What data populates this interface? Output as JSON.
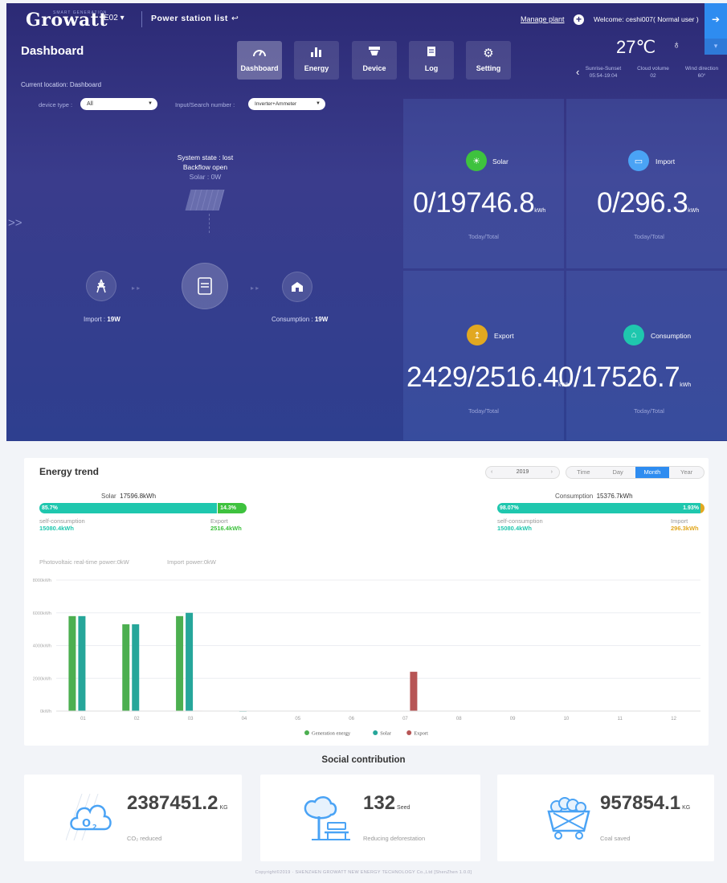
{
  "header": {
    "logo": "Growatt",
    "logo_tagline": "SMART GENERATION",
    "plant_select": "E02 ▾",
    "power_station_list": "Power station list",
    "back_arrow": "↩",
    "manage_plant": "Manage plant",
    "welcome": "Welcome: ceshi007( Normal user )"
  },
  "page_title": "Dashboard",
  "nav": [
    {
      "label": "Dashboard",
      "icon": "gauge-icon",
      "active": true
    },
    {
      "label": "Energy",
      "icon": "bar-chart-icon",
      "active": false
    },
    {
      "label": "Device",
      "icon": "device-icon",
      "active": false
    },
    {
      "label": "Log",
      "icon": "log-icon",
      "active": false
    },
    {
      "label": "Setting",
      "icon": "gear-icon",
      "active": false
    }
  ],
  "weather": {
    "temp": "27℃",
    "icon": "cloud-icon",
    "items": [
      {
        "label": "Sunrise-Sunset",
        "value": "05:54-19:04"
      },
      {
        "label": "Cloud volume",
        "value": "02"
      },
      {
        "label": "Wind direction",
        "value": "60°"
      }
    ]
  },
  "current_location": "Current location: Dashboard",
  "filters": {
    "device_type_label": "device type :",
    "device_type_value": "All",
    "search_label": "Input/Search number :",
    "search_value": "Inverter+Ammeter"
  },
  "system": {
    "state": "System state : lost",
    "backflow": "Backflow open",
    "solar": "Solar : 0W"
  },
  "flow": {
    "import_label": "Import : ",
    "import_value": "19W",
    "consumption_label": "Consumption : ",
    "consumption_value": "19W"
  },
  "stats": [
    {
      "name": "Solar",
      "value": "0/19746.8",
      "unit": "kWh",
      "sub": "Today/Total",
      "color": "#3ec23e",
      "icon": "sun-icon"
    },
    {
      "name": "Import",
      "value": "0/296.3",
      "unit": "kWh",
      "sub": "Today/Total",
      "color": "#4aa3f5",
      "icon": "import-icon"
    },
    {
      "name": "Export",
      "value": "2429/2516.4",
      "unit": "kWh",
      "sub": "Today/Total",
      "color": "#e2a820",
      "icon": "export-icon"
    },
    {
      "name": "Consumption",
      "value": "0/17526.7",
      "unit": "kWh",
      "sub": "Today/Total",
      "color": "#1fc7ae",
      "icon": "consumption-icon"
    }
  ],
  "trend": {
    "title": "Energy trend",
    "year": "2019",
    "ranges": [
      "Time",
      "Day",
      "Month",
      "Year"
    ],
    "active_range": "Month",
    "solar_summary_label": "Solar",
    "solar_summary_value": "17596.8kWh",
    "solar_self_pct": "85.7%",
    "solar_export_pct": "14.3%",
    "solar_self_label": "self-consumption",
    "solar_self_value": "15080.4kWh",
    "solar_export_label": "Export",
    "solar_export_value": "2516.4kWh",
    "cons_summary_label": "Consumption",
    "cons_summary_value": "15376.7kWh",
    "cons_self_pct": "98.07%",
    "cons_import_pct": "1.93%",
    "cons_self_label": "self-consumption",
    "cons_self_value": "15080.4kWh",
    "cons_import_label": "Import",
    "cons_import_value": "296.3kWh",
    "pv_realtime_label": "Photovoltaic real-time power:0kW",
    "import_power_label": "Import power:0kW"
  },
  "chart_data": {
    "type": "bar",
    "categories": [
      "01",
      "02",
      "03",
      "04",
      "05",
      "06",
      "07",
      "08",
      "09",
      "10",
      "11",
      "12"
    ],
    "series": [
      {
        "name": "Generation energy",
        "color": "#4caf50",
        "values": [
          5800,
          5300,
          5800,
          0,
          0,
          0,
          0,
          0,
          0,
          0,
          0,
          0
        ]
      },
      {
        "name": "Solar",
        "color": "#26a69a",
        "values": [
          5800,
          5300,
          6000,
          15,
          0,
          0,
          0,
          0,
          0,
          0,
          0,
          0
        ]
      },
      {
        "name": "Export",
        "color": "#b75555",
        "values": [
          0,
          0,
          25,
          0,
          0,
          0,
          2400,
          0,
          0,
          0,
          0,
          0
        ]
      }
    ],
    "ylim": [
      0,
      8000
    ],
    "yticks": [
      "0kWh",
      "2000kWh",
      "4000kWh",
      "6000kWh",
      "8000kWh"
    ],
    "grid": true,
    "legend": "bottom"
  },
  "social": {
    "title": "Social contribution",
    "cards": [
      {
        "value": "2387451.2",
        "unit": "KG",
        "label": "CO₂ reduced",
        "icon": "co2-cloud-icon"
      },
      {
        "value": "132",
        "unit": "Seed",
        "label": "Reducing deforestation",
        "icon": "tree-icon"
      },
      {
        "value": "957854.1",
        "unit": "KG",
        "label": "Coal saved",
        "icon": "coal-cart-icon"
      }
    ]
  },
  "footer": "Copyright©2019 · SHENZHEN GROWATT NEW ENERGY TECHNOLOGY Co.,Ltd [ShenZhen 1.0.0]"
}
